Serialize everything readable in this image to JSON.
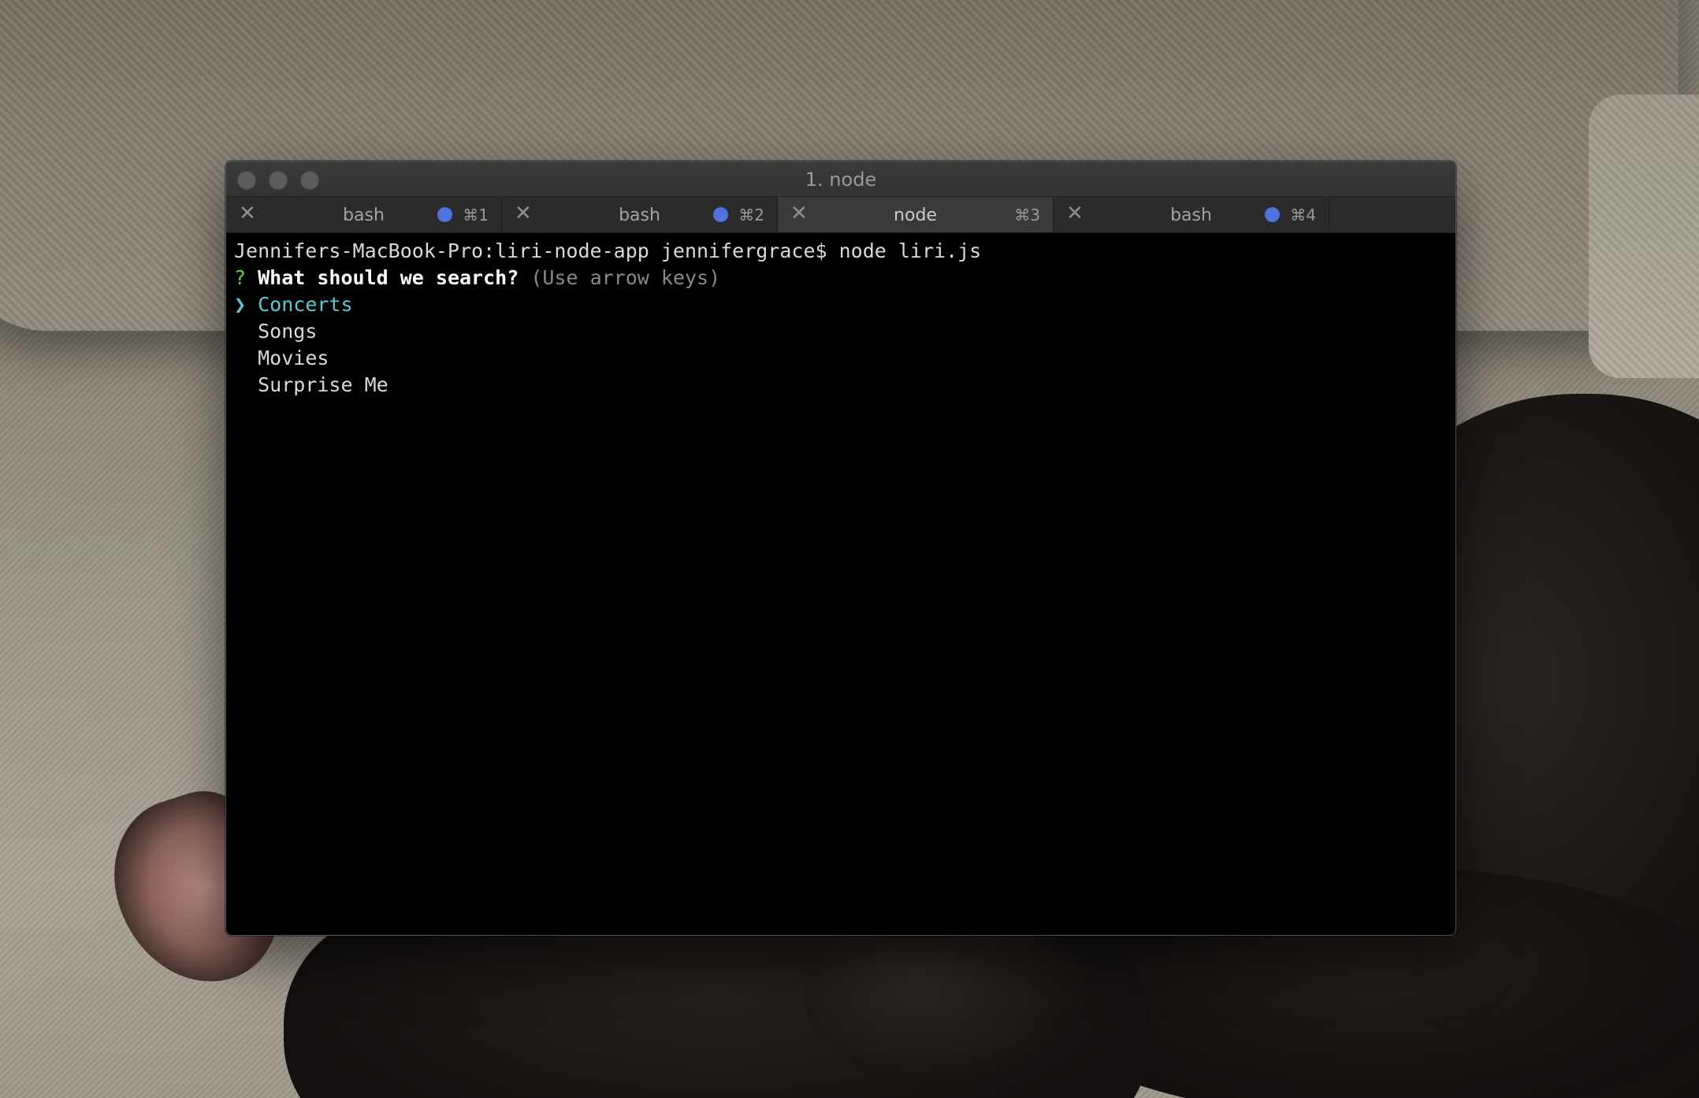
{
  "window": {
    "title": "1. node"
  },
  "tabs": [
    {
      "label": "bash",
      "shortcut": "⌘1",
      "has_activity_dot": true,
      "active": false,
      "close_glyph": "✕"
    },
    {
      "label": "bash",
      "shortcut": "⌘2",
      "has_activity_dot": true,
      "active": false,
      "close_glyph": "✕"
    },
    {
      "label": "node",
      "shortcut": "⌘3",
      "has_activity_dot": false,
      "active": true,
      "close_glyph": "✕"
    },
    {
      "label": "bash",
      "shortcut": "⌘4",
      "has_activity_dot": true,
      "active": false,
      "close_glyph": "✕"
    }
  ],
  "terminal": {
    "command_line": "Jennifers-MacBook-Pro:liri-node-app jennifergrace$ node liri.js",
    "question_mark": "?",
    "question": "What should we search?",
    "hint": "(Use arrow keys)",
    "pointer": "❯",
    "options": [
      "Concerts",
      "Songs",
      "Movies",
      "Surprise Me"
    ],
    "selected_index": 0
  },
  "colors": {
    "question_mark": "#6fcf3b",
    "selected_option": "#5bc8d2",
    "activity_dot": "#4e73dd",
    "terminal_bg": "#000000"
  }
}
